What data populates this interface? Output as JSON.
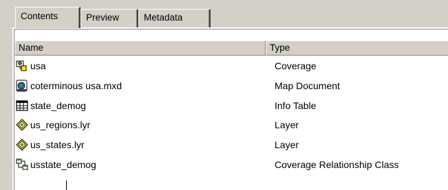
{
  "tabs": [
    {
      "label": "Contents",
      "active": true
    },
    {
      "label": "Preview",
      "active": false
    },
    {
      "label": "Metadata",
      "active": false
    }
  ],
  "columns": {
    "name": "Name",
    "type": "Type"
  },
  "rows": [
    {
      "name": "usa",
      "type": "Coverage",
      "icon": "coverage-icon"
    },
    {
      "name": "coterminous usa.mxd",
      "type": "Map Document",
      "icon": "map-document-icon"
    },
    {
      "name": "state_demog",
      "type": "Info Table",
      "icon": "info-table-icon"
    },
    {
      "name": "us_regions.lyr",
      "type": "Layer",
      "icon": "layer-icon"
    },
    {
      "name": "us_states.lyr",
      "type": "Layer",
      "icon": "layer-icon"
    },
    {
      "name": "usstate_demog",
      "type": "Coverage Relationship Class",
      "icon": "relationship-class-icon"
    }
  ]
}
